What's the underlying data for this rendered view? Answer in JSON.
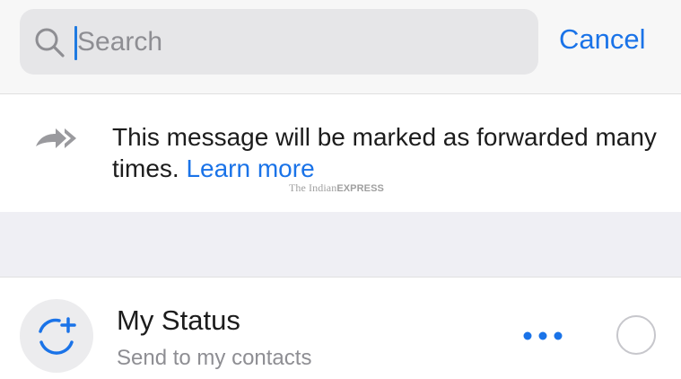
{
  "search": {
    "placeholder": "Search",
    "value": "",
    "cancel_label": "Cancel",
    "icon": "search-icon"
  },
  "notice": {
    "icon": "forward-icon",
    "message": "This message will be marked as forwarded many times.",
    "link_label": "Learn more"
  },
  "watermark": {
    "prefix": "The Indian",
    "suffix": "EXPRESS"
  },
  "status_row": {
    "avatar_icon": "add-status-icon",
    "title": "My Status",
    "subtitle": "Send to my contacts",
    "more_icon": "more-dots-icon",
    "selected": false
  },
  "colors": {
    "accent": "#1a73e8",
    "secondary_text": "#8e8e93",
    "separator_band": "#efeff4"
  }
}
